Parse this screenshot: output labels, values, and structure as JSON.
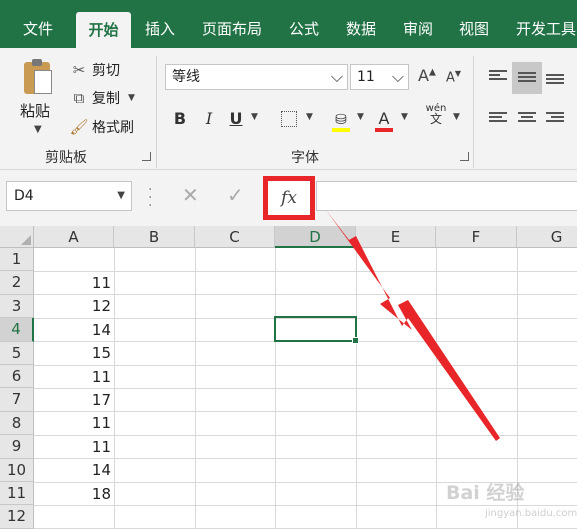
{
  "menu": {
    "tabs": [
      {
        "label": "文件"
      },
      {
        "label": "开始"
      },
      {
        "label": "插入"
      },
      {
        "label": "页面布局"
      },
      {
        "label": "公式"
      },
      {
        "label": "数据"
      },
      {
        "label": "审阅"
      },
      {
        "label": "视图"
      },
      {
        "label": "开发工具"
      }
    ],
    "active_tab": "开始"
  },
  "ribbon": {
    "clipboard": {
      "paste_label": "粘贴",
      "cut_label": "剪切",
      "copy_label": "复制",
      "format_painter_label": "格式刷",
      "group_label": "剪贴板"
    },
    "font": {
      "font_name": "等线",
      "font_size": "11",
      "group_label": "字体",
      "bold": "B",
      "italic": "I",
      "underline": "U",
      "increase_size": "A",
      "decrease_size": "A",
      "font_color": "A",
      "phonetic_top": "wén",
      "phonetic_bottom": "文"
    }
  },
  "formula_bar": {
    "name_box": "D4",
    "fx_label": "fx",
    "value": ""
  },
  "sheet": {
    "columns": [
      "A",
      "B",
      "C",
      "D",
      "E",
      "F",
      "G"
    ],
    "selected_column": "D",
    "rows": [
      "1",
      "2",
      "3",
      "4",
      "5",
      "6",
      "7",
      "8",
      "9",
      "10",
      "11",
      "12"
    ],
    "selected_row": "4",
    "column_a_values": [
      "",
      "11",
      "12",
      "14",
      "15",
      "11",
      "17",
      "11",
      "11",
      "14",
      "18",
      ""
    ]
  },
  "watermark": {
    "text": "Bai 经验",
    "sub": "jingyan.baidu.com"
  },
  "colors": {
    "excel_green": "#217346",
    "highlight_red": "#e8262a"
  }
}
